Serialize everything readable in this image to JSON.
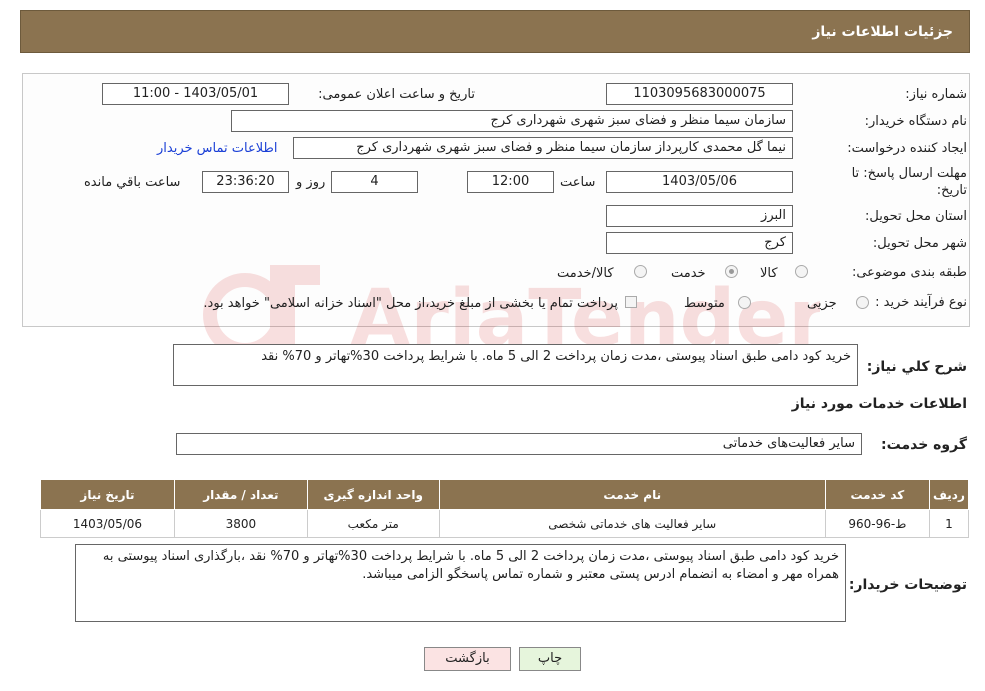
{
  "header": {
    "title": "جزئیات اطلاعات نیاز"
  },
  "form": {
    "need_number": {
      "label": "شماره نیاز:",
      "value": "1103095683000075"
    },
    "announce": {
      "label": "تاریخ و ساعت اعلان عمومی:",
      "value": "1403/05/01 - 11:00"
    },
    "buyer_org": {
      "label": "نام دستگاه خریدار:",
      "value": "سازمان سیما منظر و فضای سبز شهری شهرداری کرج"
    },
    "requester": {
      "label": "ایجاد کننده درخواست:",
      "value": "نیما گل محمدی کارپرداز سازمان سیما منظر و فضای سبز شهری شهرداری کرج",
      "contact_link": "اطلاعات تماس خریدار"
    },
    "deadline": {
      "label_line1": "مهلت ارسال پاسخ: تا",
      "label_line2": "تاریخ:",
      "date": "1403/05/06",
      "time_label": "ساعت",
      "time": "12:00",
      "days": "4",
      "days_label": "روز و",
      "remaining": "23:36:20",
      "remaining_label": "ساعت باقي مانده"
    },
    "province": {
      "label": "استان محل تحویل:",
      "value": "البرز"
    },
    "city": {
      "label": "شهر محل تحویل:",
      "value": "کرج"
    },
    "category": {
      "label": "طبقه بندی موضوعی:",
      "options": [
        "کالا",
        "خدمت",
        "کالا/خدمت"
      ],
      "selected": "خدمت"
    },
    "purchase_type": {
      "label": "نوع فرآیند خرید :",
      "options": [
        "جزیی",
        "متوسط"
      ],
      "note": "پرداخت تمام یا بخشی از مبلغ خرید،از محل \"اسناد خزانه اسلامی\" خواهد بود."
    }
  },
  "description": {
    "label": "شرح کلي نياز:",
    "value": "خرید کود دامی طبق اسناد پیوستی ،مدت زمان پرداخت 2 الی 5 ماه. با شرایط پرداخت 30%تهاتر و 70% نقد"
  },
  "services": {
    "title": "اطلاعات خدمات مورد نیاز",
    "group_label": "گروه خدمت:",
    "group_value": "سایر فعالیت‌های خدماتی",
    "columns": [
      "ردیف",
      "کد خدمت",
      "نام خدمت",
      "واحد اندازه گیری",
      "تعداد / مقدار",
      "تاریخ نیاز"
    ],
    "rows": [
      [
        "1",
        "ط-96-960",
        "سایر فعالیت های خدماتی شخصی",
        "متر مکعب",
        "3800",
        "1403/05/06"
      ]
    ]
  },
  "buyer_notes": {
    "label": "توضیحات خریدار:",
    "value": "خرید کود دامی طبق اسناد پیوستی ،مدت زمان پرداخت 2 الی 5 ماه. با شرایط پرداخت 30%تهاتر و 70% نقد ،بارگذاری اسناد پیوستی به همراه مهر و امضاء به انضمام ادرس پستی معتبر و شماره تماس پاسخگو الزامی میباشد."
  },
  "buttons": {
    "print": "چاپ",
    "back": "بازگشت"
  },
  "colors": {
    "header_bg": "#8b7350",
    "link": "#1a3fd6",
    "print_btn": "#e6f5dc",
    "back_btn": "#fbe3e3"
  },
  "watermark": {
    "text": "AriaTender.neT"
  }
}
